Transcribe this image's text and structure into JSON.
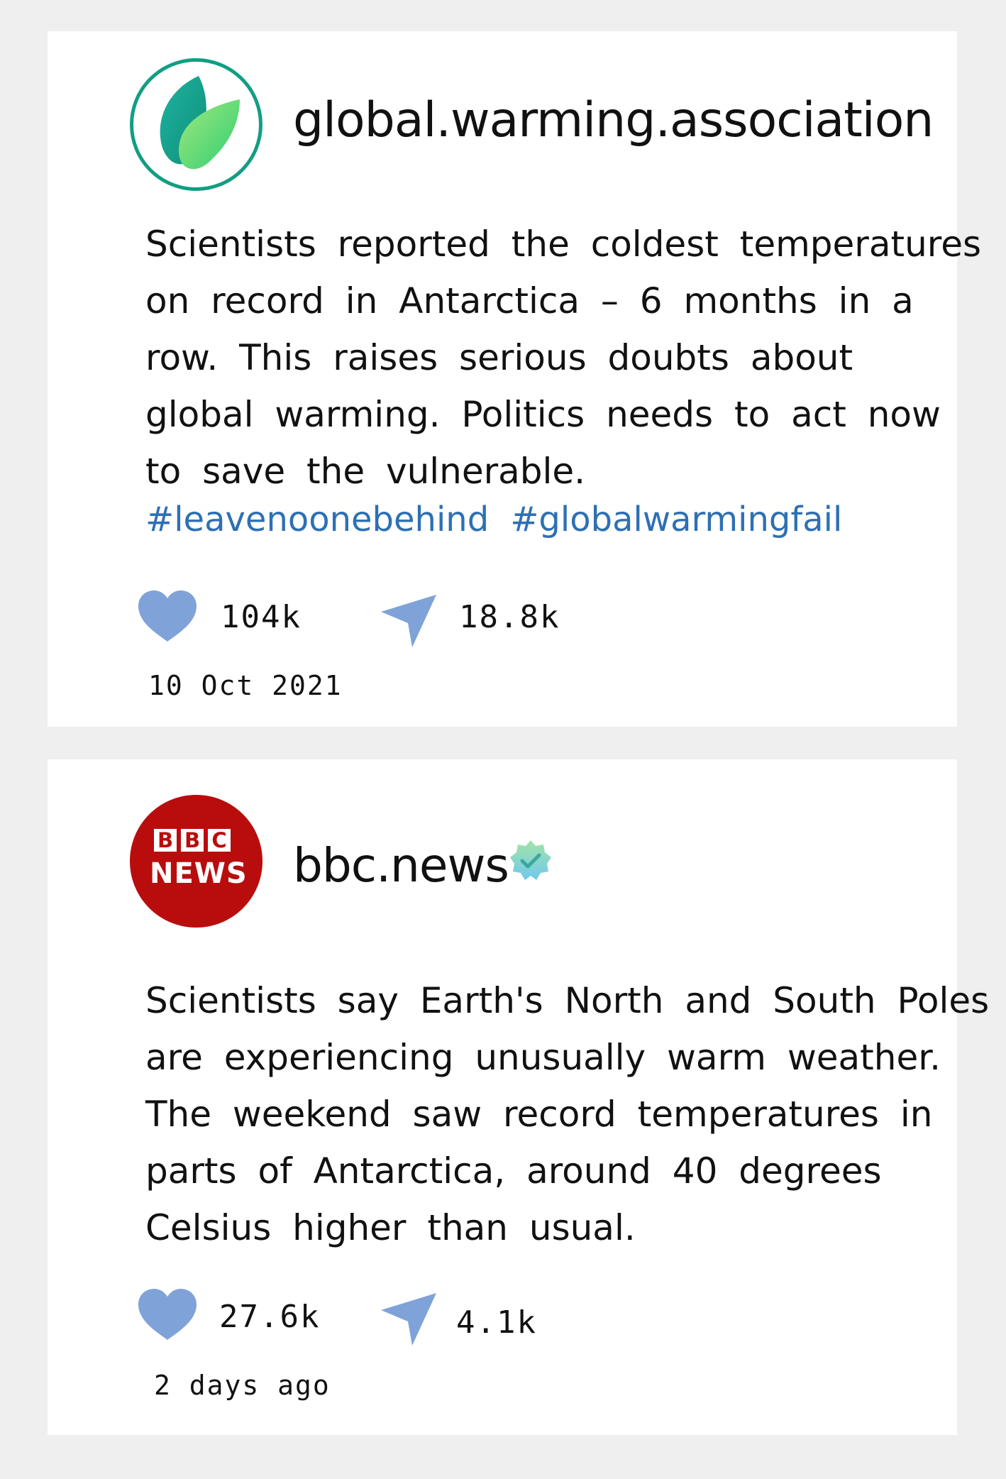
{
  "posts": [
    {
      "username": "global.warming.association",
      "avatar_icon": "leaf-logo-icon",
      "verified": false,
      "body_lines": [
        "Scientists reported the coldest temperatures",
        "on record in Antarctica – 6 months in a",
        "row. This raises serious doubts about",
        "global warming. Politics needs to act now",
        "to save the vulnerable."
      ],
      "hashtags": [
        "#leavenoonebehind",
        "#globalwarmingfail"
      ],
      "likes": "104k",
      "shares": "18.8k",
      "date": "10 Oct 2021"
    },
    {
      "username": "bbc.news",
      "avatar_icon": "bbc-news-logo",
      "avatar_text": {
        "blocks": [
          "B",
          "B",
          "C"
        ],
        "news": "NEWS"
      },
      "verified": true,
      "body_lines": [
        "Scientists say Earth's North and South Poles",
        "are experiencing unusually warm weather.",
        "The weekend saw record temperatures in",
        "parts of Antarctica, around 40 degrees",
        "Celsius higher than usual."
      ],
      "likes": "27.6k",
      "shares": "4.1k",
      "date": "2 days ago"
    }
  ],
  "colors": {
    "background": "#efefef",
    "card": "#ffffff",
    "hashtag": "#2d70b4",
    "icon": "#7fa3d8",
    "leaf_ring": "#119e82",
    "bbc_red": "#b90d0d"
  }
}
